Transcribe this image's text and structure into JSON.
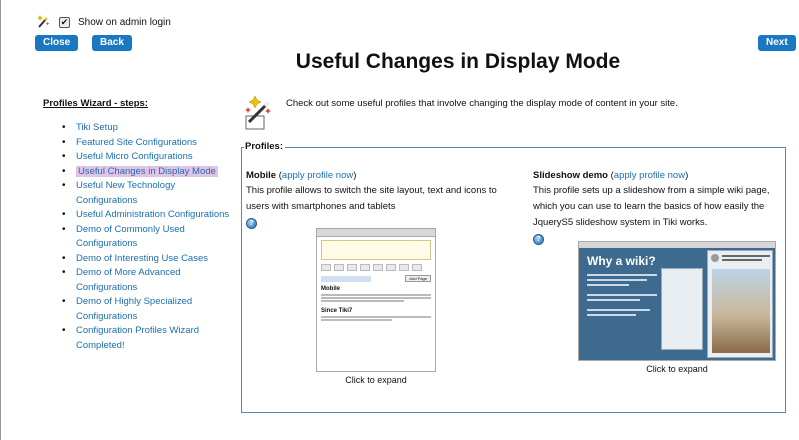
{
  "top": {
    "show_on_admin_login_label": "Show on admin login",
    "show_on_admin_login_checked": true
  },
  "buttons": {
    "close": "Close",
    "back": "Back",
    "next": "Next"
  },
  "title": "Useful Changes in Display Mode",
  "sidebar": {
    "heading": "Profiles Wizard - steps:",
    "items": [
      {
        "label": "Tiki Setup"
      },
      {
        "label": "Featured Site Configurations"
      },
      {
        "label": "Useful Micro Configurations"
      },
      {
        "label": "Useful Changes in Display Mode",
        "active": true
      },
      {
        "label": "Useful New Technology Configurations"
      },
      {
        "label": "Useful Administration Configurations"
      },
      {
        "label": "Demo of Commonly Used Configurations"
      },
      {
        "label": "Demo of Interesting Use Cases"
      },
      {
        "label": "Demo of More Advanced Configurations"
      },
      {
        "label": "Demo of Highly Specialized Configurations"
      },
      {
        "label": "Configuration Profiles Wizard Completed!"
      }
    ]
  },
  "intro": "Check out some useful profiles that involve changing the display mode of content in your site.",
  "profiles": {
    "legend": "Profiles:",
    "mobile": {
      "name": "Mobile",
      "apply_link": "apply profile now",
      "description": "This profile allows to switch the site layout, text and icons to users with smartphones and tablets",
      "caption": "Click to expand"
    },
    "slideshow": {
      "name": "Slideshow demo",
      "apply_link": "apply profile now",
      "description": "This profile sets up a slideshow from a simple wiki page, which you can use to learn the basics of how easily the JqueryS5 slideshow system in Tiki works.",
      "caption": "Click to expand"
    }
  },
  "thumbs": {
    "mobile": {
      "page_title": "Mobile",
      "section": "Since Tiki7",
      "add_page": "Add Page"
    },
    "slideshow": {
      "heading": "Why a wiki?"
    }
  },
  "colors": {
    "button_bg": "#1a78c2",
    "link": "#1b6fb0",
    "active_highlight": "#e3c3e5",
    "fieldset_border": "#4d8bbf"
  },
  "icons": {
    "wizard": "wand-icon",
    "help": "help-icon"
  }
}
